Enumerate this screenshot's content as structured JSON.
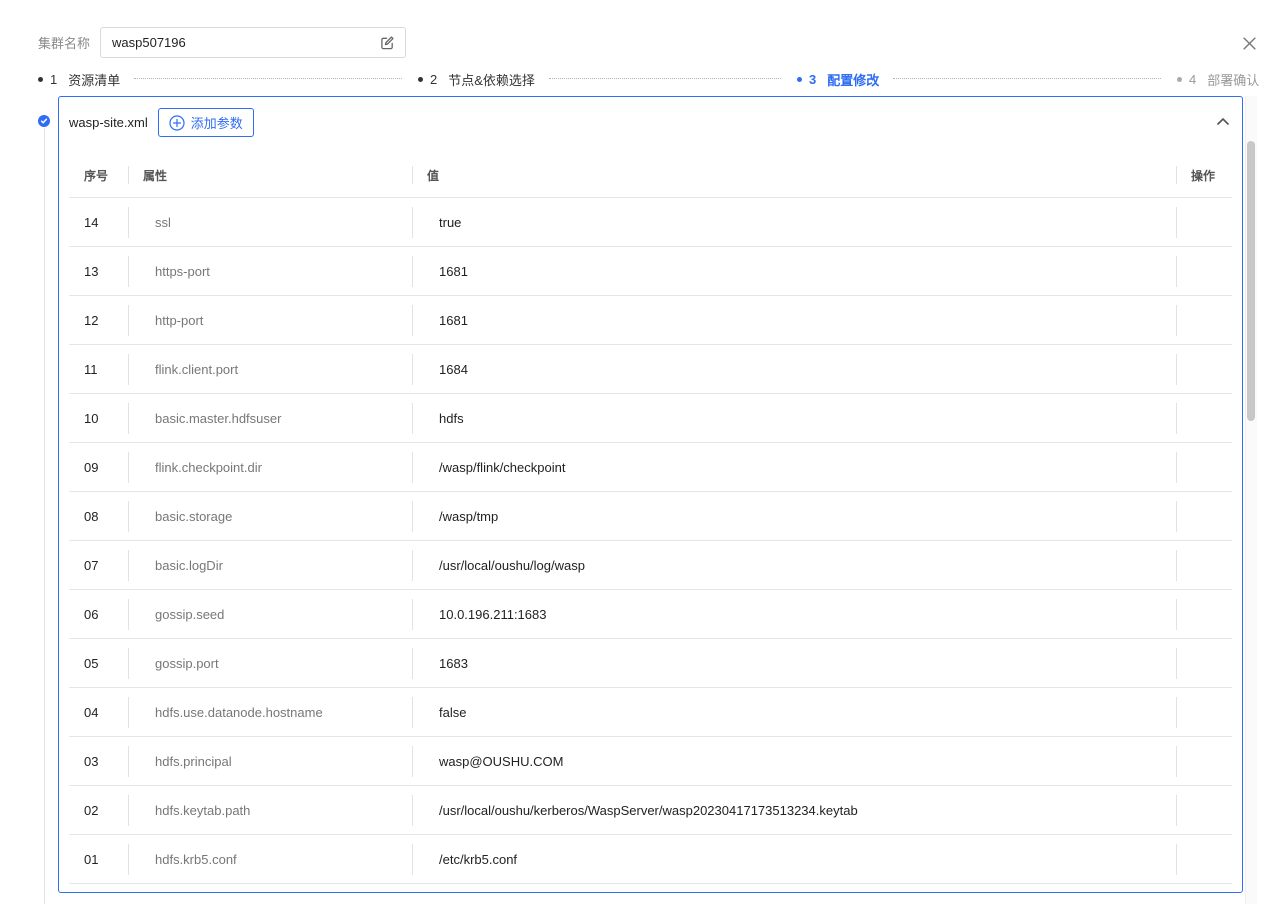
{
  "header": {
    "cluster_label": "集群名称",
    "cluster_name": "wasp507196"
  },
  "steps": [
    {
      "num": "1",
      "label": "资源清单",
      "state": "done"
    },
    {
      "num": "2",
      "label": "节点&依赖选择",
      "state": "done"
    },
    {
      "num": "3",
      "label": "配置修改",
      "state": "active"
    },
    {
      "num": "4",
      "label": "部署确认",
      "state": "pending"
    }
  ],
  "panel": {
    "file_name": "wasp-site.xml",
    "add_button_label": "添加参数"
  },
  "table": {
    "columns": [
      "序号",
      "属性",
      "值",
      "操作"
    ],
    "rows": [
      {
        "idx": "14",
        "prop": "ssl",
        "value": "true"
      },
      {
        "idx": "13",
        "prop": "https-port",
        "value": "1681"
      },
      {
        "idx": "12",
        "prop": "http-port",
        "value": "1681"
      },
      {
        "idx": "11",
        "prop": "flink.client.port",
        "value": "1684"
      },
      {
        "idx": "10",
        "prop": "basic.master.hdfsuser",
        "value": "hdfs"
      },
      {
        "idx": "09",
        "prop": "flink.checkpoint.dir",
        "value": "/wasp/flink/checkpoint"
      },
      {
        "idx": "08",
        "prop": "basic.storage",
        "value": "/wasp/tmp"
      },
      {
        "idx": "07",
        "prop": "basic.logDir",
        "value": "/usr/local/oushu/log/wasp"
      },
      {
        "idx": "06",
        "prop": "gossip.seed",
        "value": "10.0.196.211:1683"
      },
      {
        "idx": "05",
        "prop": "gossip.port",
        "value": "1683"
      },
      {
        "idx": "04",
        "prop": "hdfs.use.datanode.hostname",
        "value": "false"
      },
      {
        "idx": "03",
        "prop": "hdfs.principal",
        "value": "wasp@OUSHU.COM"
      },
      {
        "idx": "02",
        "prop": "hdfs.keytab.path",
        "value": "/usr/local/oushu/kerberos/WaspServer/wasp20230417173513234.keytab"
      },
      {
        "idx": "01",
        "prop": "hdfs.krb5.conf",
        "value": "/etc/krb5.conf"
      }
    ]
  },
  "colors": {
    "accent": "#2f6df3",
    "border": "#e6e6e6"
  }
}
